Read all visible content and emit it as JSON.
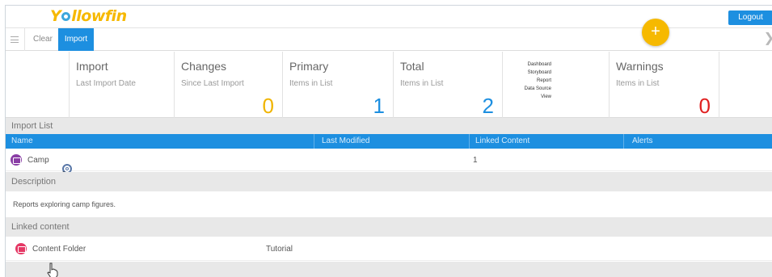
{
  "header": {
    "logo_text": "Yellowfin",
    "logout_label": "Logout"
  },
  "toolbar": {
    "menu_icon": "hamburger-icon",
    "clear_label": "Clear",
    "import_label": "Import",
    "close_icon": "close-icon",
    "fab_label": "+"
  },
  "stats": [
    {
      "title": "Import",
      "subtitle": "Last Import Date",
      "value": ""
    },
    {
      "title": "Changes",
      "subtitle": "Since Last Import",
      "value": "0"
    },
    {
      "title": "Primary",
      "subtitle": "Items in List",
      "value": "1"
    },
    {
      "title": "Total",
      "subtitle": "Items in List",
      "value": "2"
    },
    {
      "title": "Warnings",
      "subtitle": "Items in List",
      "value": "0"
    }
  ],
  "content_types": [
    "Dashboard",
    "Storyboard",
    "Report",
    "Data Source",
    "View"
  ],
  "import_list": {
    "heading": "Import List",
    "columns": [
      "Name",
      "Last Modified",
      "Linked Content",
      "Alerts"
    ],
    "rows": [
      {
        "name": "Camp",
        "last_modified": "",
        "linked_content": "1",
        "alerts": ""
      }
    ]
  },
  "description": {
    "heading": "Description",
    "text": "Reports exploring camp figures."
  },
  "linked_content": {
    "heading": "Linked content",
    "items": [
      {
        "name": "Content Folder",
        "folder": "Tutorial"
      }
    ]
  },
  "colors": {
    "accent_blue": "#1d8fe0",
    "brand_yellow": "#f6b800",
    "warning_red": "#e02020",
    "report_purple": "#8a3ea5",
    "folder_pink": "#e53865"
  }
}
